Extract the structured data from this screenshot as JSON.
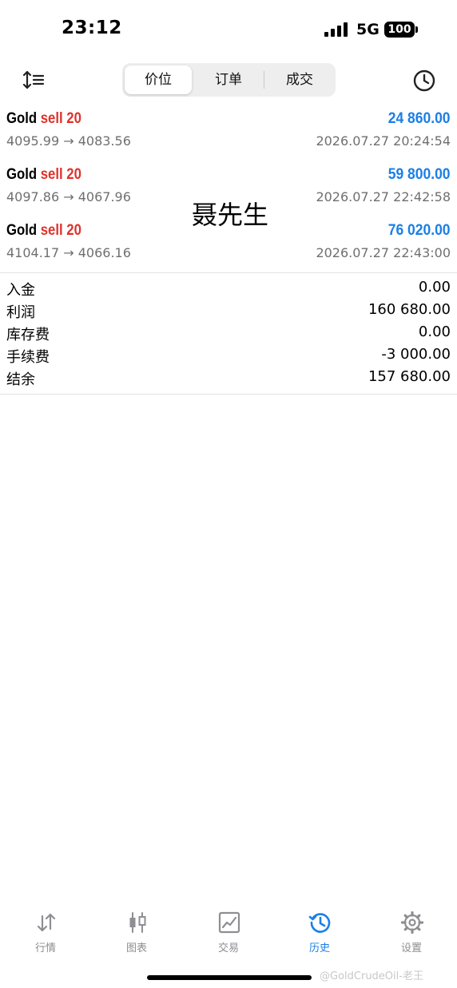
{
  "status_bar": {
    "time": "23:12",
    "network": "5G",
    "battery": "100"
  },
  "segments": [
    {
      "label": "价位",
      "active": true
    },
    {
      "label": "订单",
      "active": false
    },
    {
      "label": "成交",
      "active": false
    }
  ],
  "deals": [
    {
      "symbol": "Gold",
      "side": "sell 20",
      "profit": "24 860.00",
      "prices": "4095.99 → 4083.56",
      "time": "2026.07.27 20:24:54"
    },
    {
      "symbol": "Gold",
      "side": "sell 20",
      "profit": "59 800.00",
      "prices": "4097.86 → 4067.96",
      "time": "2026.07.27 22:42:58"
    },
    {
      "symbol": "Gold",
      "side": "sell 20",
      "profit": "76 020.00",
      "prices": "4104.17 → 4066.16",
      "time": "2026.07.27 22:43:00"
    }
  ],
  "overlay_name": "聂先生",
  "summary": [
    {
      "label": "入金",
      "value": "0.00"
    },
    {
      "label": "利润",
      "value": "160 680.00"
    },
    {
      "label": "库存费",
      "value": "0.00"
    },
    {
      "label": "手续费",
      "value": "-3 000.00"
    },
    {
      "label": "结余",
      "value": "157 680.00"
    }
  ],
  "tabs": [
    {
      "label": "行情",
      "icon": "quotes-arrows-icon",
      "active": false
    },
    {
      "label": "图表",
      "icon": "candlestick-icon",
      "active": false
    },
    {
      "label": "交易",
      "icon": "trade-chart-icon",
      "active": false
    },
    {
      "label": "历史",
      "icon": "history-clock-icon",
      "active": true
    },
    {
      "label": "设置",
      "icon": "gear-icon",
      "active": false
    }
  ],
  "source_watermark": "@GoldCrudeOil-老王",
  "colors": {
    "sell": "#e0312a",
    "profit": "#1a7fe6",
    "active_tab": "#1a7fe6",
    "inactive_tab": "#8e8e93"
  }
}
